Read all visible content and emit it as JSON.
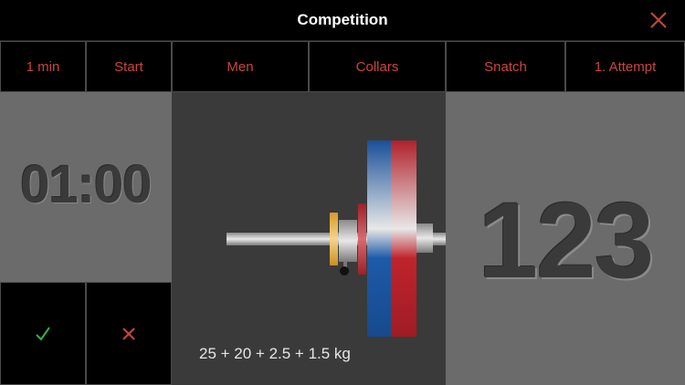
{
  "header": {
    "title": "Competition",
    "close_icon": "close-icon"
  },
  "toolbar": {
    "timer_duration": "1 min",
    "start": "Start",
    "category": "Men",
    "collars": "Collars",
    "lift": "Snatch",
    "attempt": "1. Attempt"
  },
  "timer": {
    "display": "01:00"
  },
  "judging": {
    "good_lift_icon": "check-icon",
    "no_lift_icon": "cross-icon"
  },
  "barbell": {
    "plates_text": "25 + 20 + 2.5 + 1.5 kg",
    "plates": [
      {
        "kg": 25,
        "color": "#c0232b"
      },
      {
        "kg": 20,
        "color": "#1d5aa8"
      },
      {
        "kg": 2.5,
        "color": "#c0232b"
      },
      {
        "kg": 1.5,
        "color": "#e2b33c"
      }
    ]
  },
  "attempt_weight": "123",
  "colors": {
    "accent": "#c9463c",
    "ok": "#33b24a",
    "panel": "#6b6b6b",
    "center": "#3a3a3a"
  }
}
